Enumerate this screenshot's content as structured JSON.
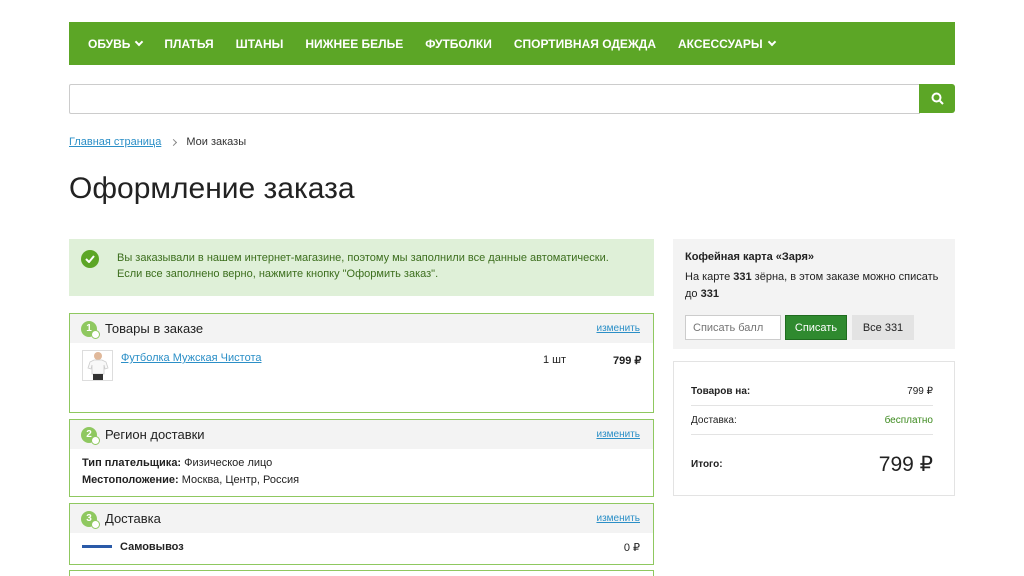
{
  "nav": {
    "items": [
      {
        "label": "ОБУВЬ",
        "has_dropdown": true
      },
      {
        "label": "ПЛАТЬЯ",
        "has_dropdown": false
      },
      {
        "label": "ШТАНЫ",
        "has_dropdown": false
      },
      {
        "label": "НИЖНЕЕ БЕЛЬЕ",
        "has_dropdown": false
      },
      {
        "label": "ФУТБОЛКИ",
        "has_dropdown": false
      },
      {
        "label": "СПОРТИВНАЯ ОДЕЖДА",
        "has_dropdown": false
      },
      {
        "label": "АКСЕССУАРЫ",
        "has_dropdown": true
      }
    ]
  },
  "search": {
    "placeholder": "",
    "icon": "search-icon"
  },
  "breadcrumb": {
    "home": "Главная страница",
    "current": "Мои заказы"
  },
  "page_title": "Оформление заказа",
  "notice": {
    "line1": "Вы заказывали в нашем интернет-магазине, поэтому мы заполнили все данные автоматически.",
    "line2": "Если все заполнено верно, нажмите кнопку \"Оформить заказ\"."
  },
  "blocks": {
    "goods": {
      "step": "1",
      "title": "Товары в заказе",
      "edit": "изменить",
      "product": {
        "name": "Футболка Мужская Чистота",
        "qty": "1 шт",
        "price": "799 ₽"
      }
    },
    "region": {
      "step": "2",
      "title": "Регион доставки",
      "edit": "изменить",
      "payer_label": "Тип плательщика:",
      "payer_value": "Физическое лицо",
      "location_label": "Местоположение:",
      "location_value": "Москва, Центр, Россия"
    },
    "delivery": {
      "step": "3",
      "title": "Доставка",
      "edit": "изменить",
      "method": "Самовывоз",
      "price": "0 ₽"
    }
  },
  "coffee_card": {
    "title": "Кофейная карта «Заря»",
    "text_prefix": "На карте ",
    "balance": "331",
    "text_mid": " зёрна, в этом заказе можно списать до ",
    "max_spend": "331",
    "input_placeholder": "Списать балл",
    "spend_button": "Списать",
    "all_button": "Все 331"
  },
  "summary": {
    "goods_label": "Товаров на:",
    "goods_value": "799 ₽",
    "delivery_label": "Доставка:",
    "delivery_value": "бесплатно",
    "total_label": "Итого:",
    "total_value": "799 ₽"
  },
  "colors": {
    "brand_green": "#5ca626",
    "link_blue": "#2b8fc7",
    "notice_bg": "#dff0d8"
  }
}
